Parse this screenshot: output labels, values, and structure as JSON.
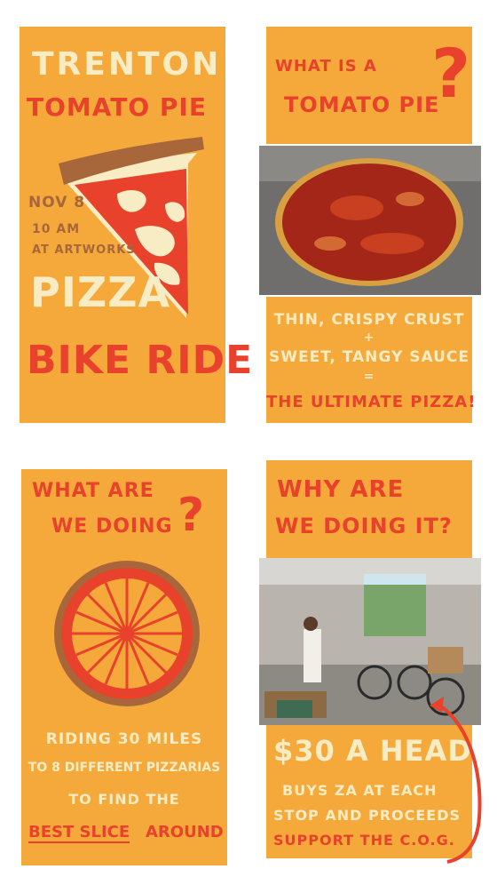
{
  "colors": {
    "panel": "#f6a93b",
    "cream": "#f8ecc4",
    "red": "#e8412c",
    "crust": "#a8673a"
  },
  "panel1": {
    "line1": "TRENTON",
    "line2": "TOMATO PIE",
    "date": "NOV 8",
    "time": "10 AM",
    "place": "AT ARTWORKS",
    "word1": "PIZZA",
    "word2": "BIKE RIDE"
  },
  "panel2": {
    "q_line1": "WHAT IS A",
    "q_line2": "TOMATO PIE",
    "q_mark": "?",
    "line1": "THIN, CRISPY CRUST",
    "plus": "+",
    "line2": "SWEET, TANGY SAUCE",
    "equals": "=",
    "line3": "THE ULTIMATE PIZZA!"
  },
  "panel3": {
    "q_line1": "WHAT ARE",
    "q_line2": "WE DOING",
    "q_mark": "?",
    "line1": "RIDING 30 MILES",
    "line2": "TO 8 DIFFERENT PIZZARIAS",
    "line3": "TO FIND THE",
    "line4a": "BEST SLICE",
    "line4b": "AROUND"
  },
  "panel4": {
    "q_line1": "WHY ARE",
    "q_line2": "WE DOING IT?",
    "price": "$30 A HEAD",
    "line1": "BUYS ZA AT EACH",
    "line2": "STOP AND PROCEEDS",
    "line3": "SUPPORT THE C.O.G."
  },
  "icons": [
    "pizza-slice-icon",
    "tomato-pie-photo",
    "bike-wheel-icon",
    "workshop-photo",
    "curved-arrow-icon"
  ]
}
